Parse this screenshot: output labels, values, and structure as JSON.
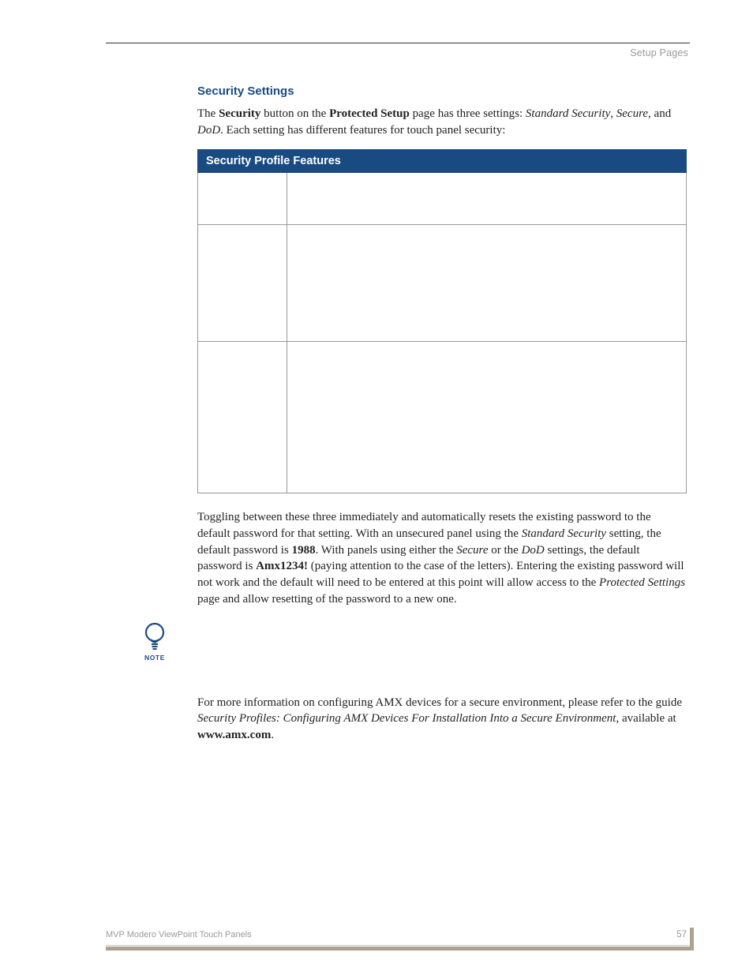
{
  "header": {
    "breadcrumb": "Setup Pages"
  },
  "section": {
    "heading": "Security Settings",
    "intro": {
      "t1": "The ",
      "b1": "Security",
      "t2": " button on the ",
      "b2": "Protected Setup",
      "t3": " page has three settings: ",
      "i1": "Standard Security",
      "t4": ", ",
      "i2": "Secure",
      "t5": ", and ",
      "i3": "DoD",
      "t6": ".  Each setting has different features for touch panel security:"
    }
  },
  "table": {
    "title": "Security Profile Features"
  },
  "para2": {
    "t1": "Toggling between these three immediately and automatically resets the existing password to the default password for that setting.  With an unsecured panel using the ",
    "i1": "Standard Security",
    "t2": " setting, the default password is ",
    "b1": "1988",
    "t3": ".  With panels using either the ",
    "i2": "Secure",
    "t4": " or the ",
    "i3": "DoD",
    "t5": " settings, the default password is ",
    "b2": "Amx1234!",
    "t6": " (paying attention to the case of the letters).  Entering the existing password will not work and the default will need to be entered at this point will allow access to the ",
    "i4": "Protected Settings",
    "t7": " page and allow resetting of the password to a new one."
  },
  "note": {
    "label": "NOTE"
  },
  "para3": {
    "t1": "For more information on configuring AMX devices for a secure environment, please refer to the guide ",
    "i1": "Security Profiles: Configuring AMX Devices For Installation Into a Secure Environment",
    "t2": ", available at ",
    "b1": "www.amx.com",
    "t3": "."
  },
  "footer": {
    "left": "MVP Modero ViewPoint Touch Panels",
    "page": "57"
  }
}
